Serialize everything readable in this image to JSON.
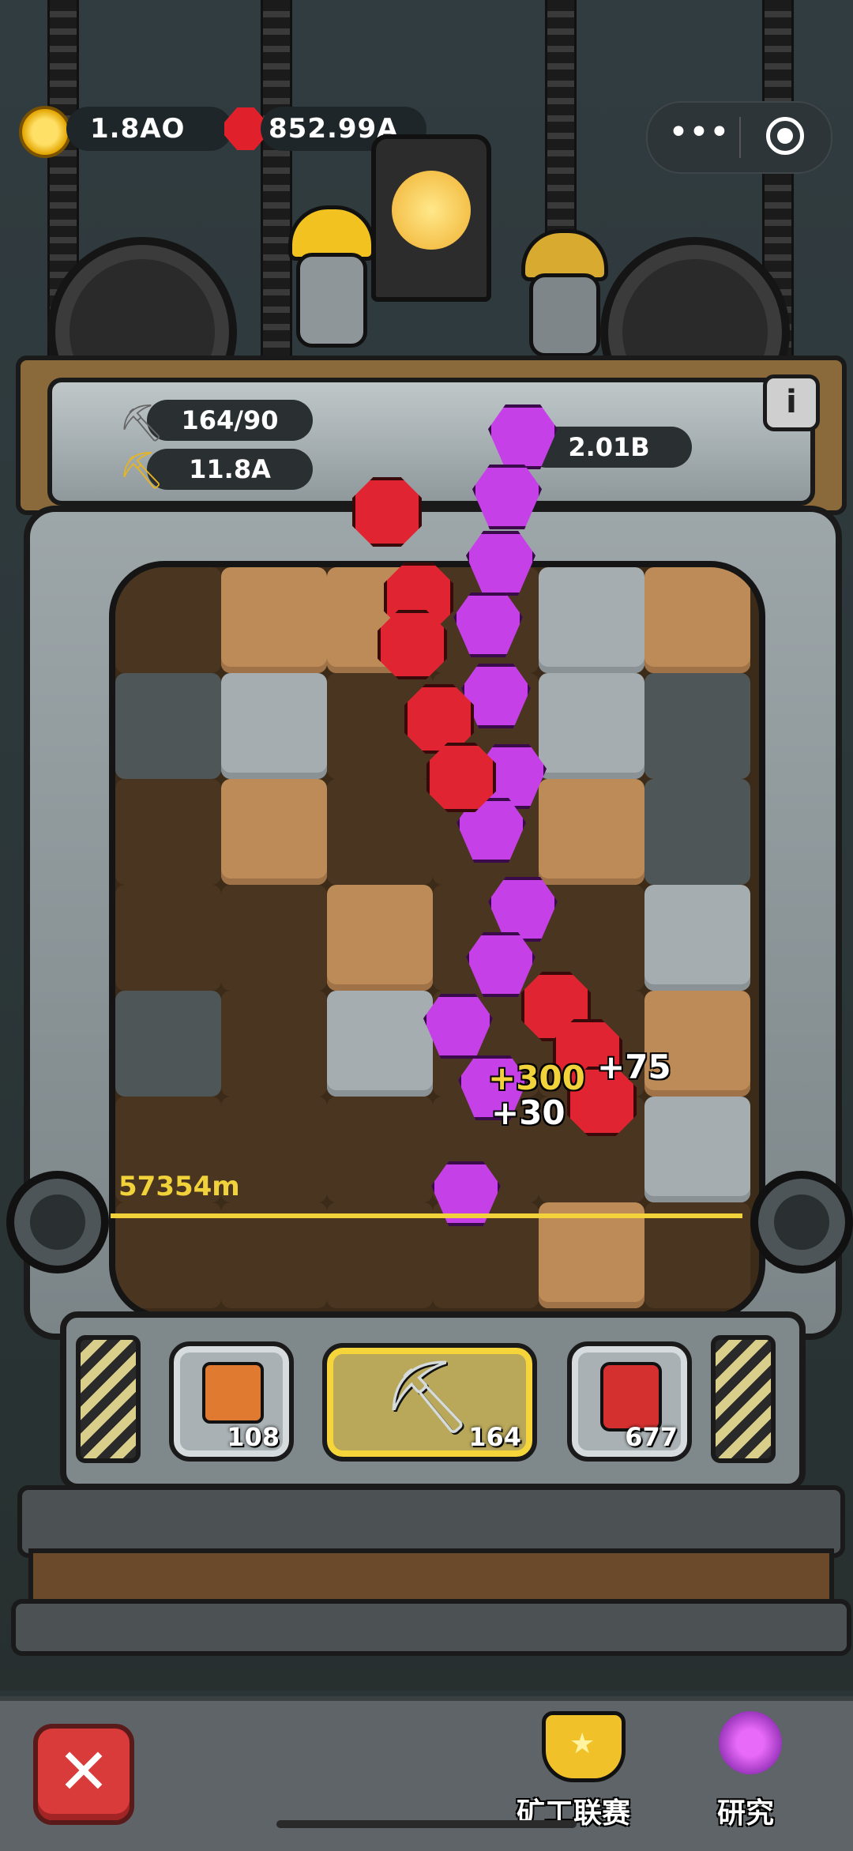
{
  "currency": {
    "gold": "1.8AO",
    "ruby": "852.99A"
  },
  "capsule": {
    "more_icon": "more-dots-icon",
    "target_icon": "target-icon"
  },
  "stats": {
    "capacity": "164/90",
    "power": "11.8A",
    "gem_total": "2.01B"
  },
  "depth": "57354m",
  "floating_numbers": [
    "+300",
    "+75",
    "+30"
  ],
  "tools": [
    {
      "name": "drill",
      "count": "108"
    },
    {
      "name": "pickaxe",
      "count": "164"
    },
    {
      "name": "dynamite",
      "count": "677"
    }
  ],
  "bottom_nav": {
    "league_label": "矿工联赛",
    "research_label": "研究"
  },
  "colors": {
    "accent_gold": "#f1d23a",
    "ruby": "#e12431",
    "amethyst": "#c640e8",
    "close_red": "#d93a3a"
  }
}
